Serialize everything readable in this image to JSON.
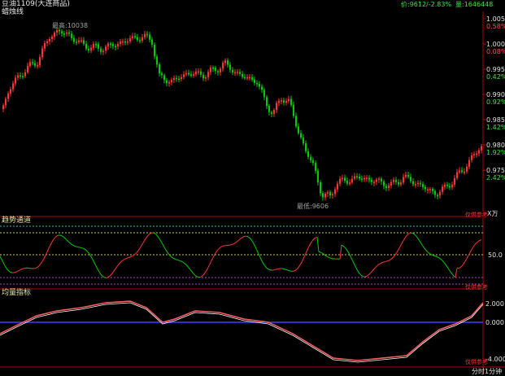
{
  "header": {
    "symbol": "豆油1109(大连商品)",
    "indicator": "蜡烛线",
    "quote_price": "价:9612/-2.83%",
    "quote_volume": "量:1646448"
  },
  "annotations": {
    "high_label": "最高:10038",
    "low_label": "最低:9606"
  },
  "panels": {
    "price_axis": [
      {
        "v": "1.005",
        "p": "0.58%"
      },
      {
        "v": "1.000",
        "p": "0.08%"
      },
      {
        "v": "0.995",
        "p": "0.42%"
      },
      {
        "v": "0.990",
        "p": "0.92%"
      },
      {
        "v": "0.985",
        "p": "1.42%"
      },
      {
        "v": "0.980",
        "p": "1.92%"
      },
      {
        "v": "0.975",
        "p": "2.42%"
      }
    ],
    "price_unit": "X万",
    "osc1_name": "趋势通道",
    "osc1_axis": "50.0",
    "osc2_name": "均量指标",
    "osc2_axis": [
      "2.000",
      "0.000",
      "-4.000"
    ],
    "corner_tag": "仅供参考",
    "time_label": "分时1分钟"
  },
  "colors": {
    "up": "#ff3333",
    "down": "#00cc00",
    "axis": "#b00000",
    "yellow_text": "#e8e8a0",
    "dotted_yellow": "#c8c860",
    "dotted_teal": "#40b0b0",
    "dotted_magenta": "#c040c0",
    "blue_zero": "#4040ff"
  }
}
